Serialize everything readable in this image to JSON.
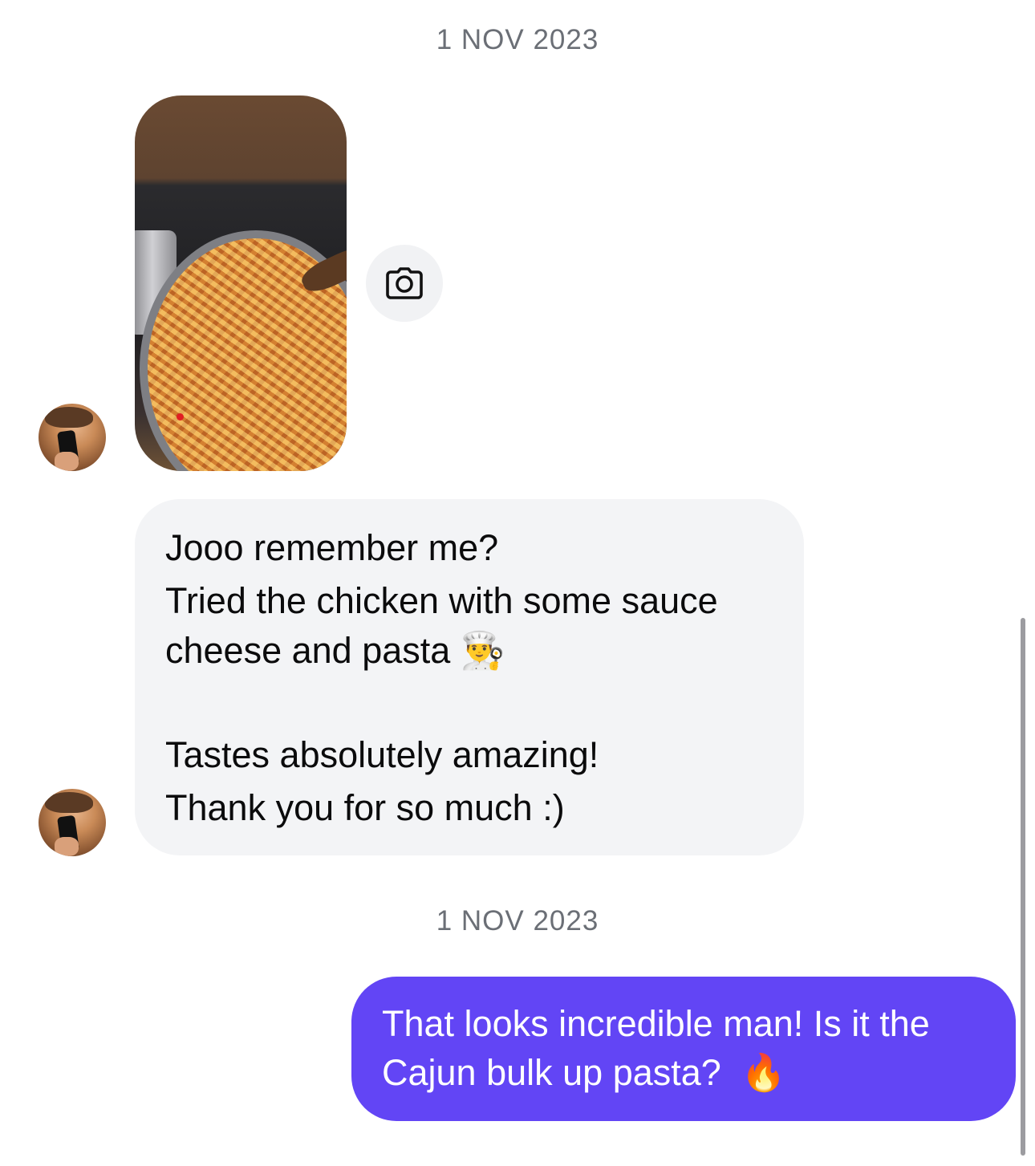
{
  "date_separators": [
    "1 NOV 2023",
    "1 NOV 2023"
  ],
  "incoming": {
    "photo_alt": "pasta-photo",
    "camera_icon": "camera-icon",
    "message_lines_1": [
      "Jooo remember me?",
      "Tried the chicken with some sauce",
      "cheese and pasta 👨‍🍳"
    ],
    "message_lines_2": [
      "Tastes absolutely amazing!",
      "Thank you for so much :)"
    ]
  },
  "outgoing": {
    "message_lines": [
      "That looks incredible man! Is it the",
      "Cajun bulk up pasta?  🔥"
    ],
    "bubble_color": "#6245f5"
  },
  "colors": {
    "incoming_bubble": "#f3f4f6",
    "date_text": "#6b6f76"
  }
}
